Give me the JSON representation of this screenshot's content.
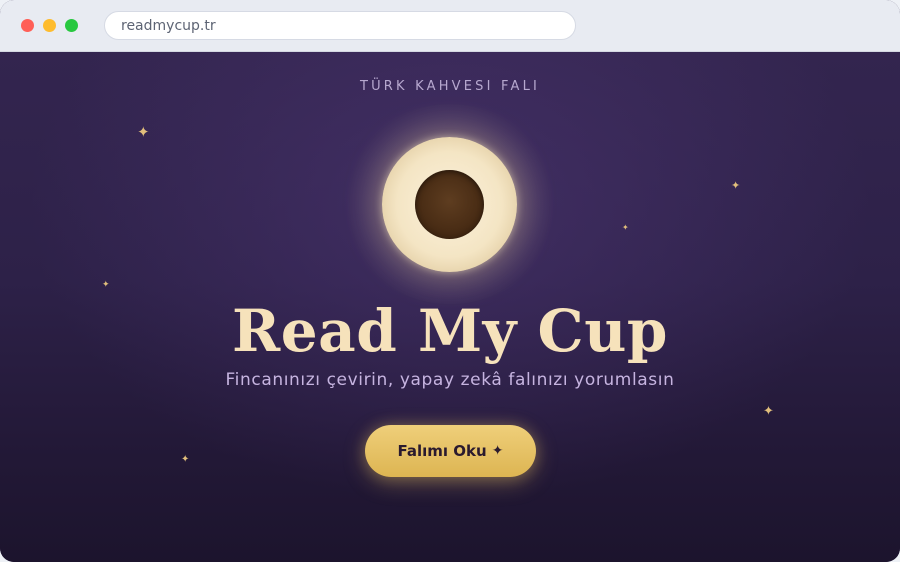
{
  "browser": {
    "url": "readmycup.tr"
  },
  "hero": {
    "eyebrow": "TÜRK KAHVESI FALI",
    "title": "Read My Cup",
    "subtitle": "Fincanınızı çevirin, yapay zekâ falınızı yorumlasın",
    "cta_label": "Falımı Oku",
    "cta_icon": "✦"
  },
  "decor": {
    "star_glyph": "✦",
    "star_color": "#e2bf7c"
  },
  "colors": {
    "title": "#f6e2bb",
    "subtitle": "#c6b4e0",
    "accent": "#ddb552",
    "background": "#2a1d45"
  }
}
